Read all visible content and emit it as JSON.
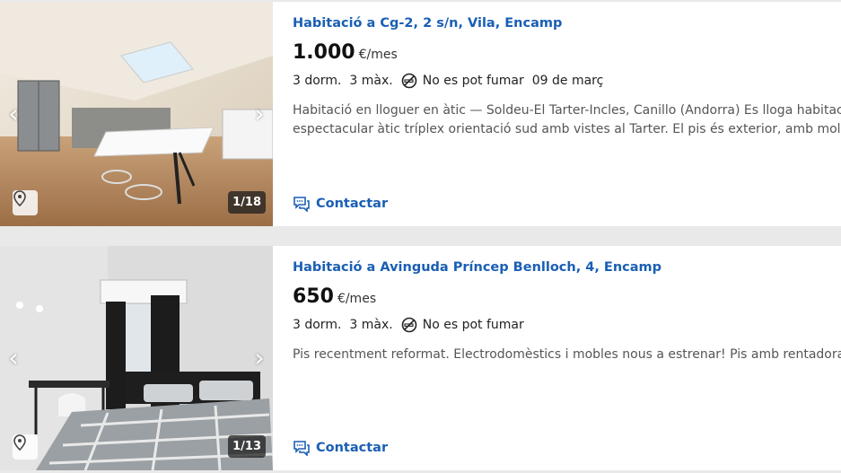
{
  "listings": [
    {
      "title": "Habitació a Cg-2, 2 s/n, Vila, Encamp",
      "price": "1.000",
      "price_unit": "€/mes",
      "bedrooms": "3 dorm.",
      "max": "3 màx.",
      "smoking": "No es pot fumar",
      "date": "09 de març",
      "desc_line1": "Habitació en lloguer en àtic — Soldeu-El Tarter-Incles, Canillo (Andorra) Es lloga habitació",
      "desc_line2": "espectacular àtic tríplex orientació sud amb vistes al Tarter. El pis és exterior, amb molta ll",
      "photo_counter": "1/18",
      "contact_label": "Contactar",
      "prev_icon": "chevron-left-icon",
      "next_icon": "chevron-right-icon"
    },
    {
      "title": "Habitació a Avinguda Príncep Benlloch, 4, Encamp",
      "price": "650",
      "price_unit": "€/mes",
      "bedrooms": "3 dorm.",
      "max": "3 màx.",
      "smoking": "No es pot fumar",
      "desc_line1": "Pis recentment reformat. Electrodomèstics i mobles nous a estrenar! Pis amb rentadora i",
      "photo_counter": "1/13",
      "contact_label": "Contactar",
      "prev_icon": "chevron-left-icon",
      "next_icon": "chevron-right-icon"
    }
  ],
  "colors": {
    "link": "#1a5fb4",
    "background": "#e9e9e9",
    "card": "#ffffff"
  }
}
